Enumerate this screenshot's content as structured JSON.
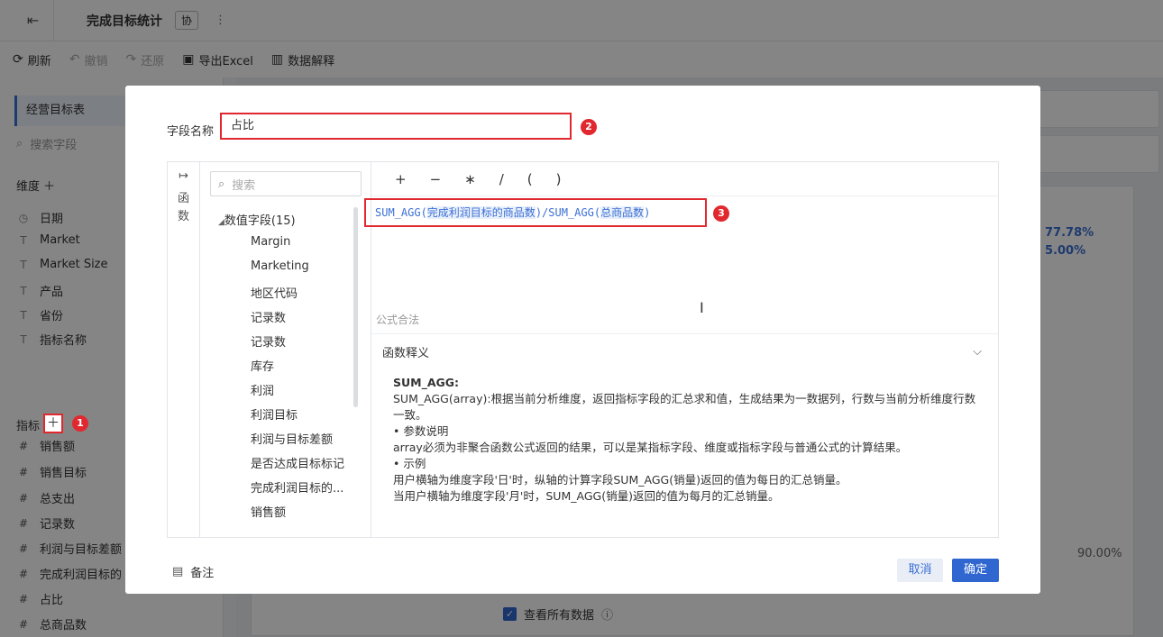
{
  "app": {
    "title": "完成目标统计",
    "badge": "协",
    "more": "⋮"
  },
  "toolbar": {
    "refresh": "刷新",
    "undo": "撤销",
    "redo": "还原",
    "export": "导出Excel",
    "explain": "数据解释"
  },
  "sidebar": {
    "table_name": "经营目标表",
    "search_placeholder": "搜索字段",
    "dimension_label": "维度",
    "dimensions": [
      "日期",
      "Market",
      "Market Size",
      "产品",
      "省份",
      "指标名称"
    ],
    "measure_label": "指标",
    "measures": [
      "销售额",
      "销售目标",
      "总支出",
      "记录数",
      "利润与目标差额",
      "完成利润目标的",
      "占比",
      "总商品数"
    ]
  },
  "background": {
    "pct1": "77.78%",
    "pct2": "5.00%",
    "pct3": "90.00%",
    "view_all": "查看所有数据"
  },
  "dialog": {
    "field_name_label": "字段名称",
    "field_name_value": "占比",
    "rail_label_1": "函",
    "rail_label_2": "数",
    "search_placeholder": "搜索",
    "group_label": "数值字段(15)",
    "fields": [
      "Margin",
      "Marketing",
      "地区代码",
      "记录数",
      "记录数",
      "库存",
      "利润",
      "利润目标",
      "利润与目标差额",
      "是否达成目标标记",
      "完成利润目标的...",
      "销售额"
    ],
    "operators": [
      "+",
      "−",
      "∗",
      "/",
      "(",
      ")"
    ],
    "formula": {
      "fn1": "SUM_AGG(",
      "arg1": "完成利润目标的商品数",
      "mid": ")/SUM_AGG(",
      "arg2": "总商品数",
      "end": ")"
    },
    "valid_text": "公式合法",
    "desc_title": "函数释义",
    "desc": {
      "name": "SUM_AGG:",
      "line1": "SUM_AGG(array):根据当前分析维度，返回指标字段的汇总求和值，生成结果为一数据列，行数与当前分析维度行数一致。",
      "param_head": "• 参数说明",
      "param": "array必须为非聚合函数公式返回的结果，可以是某指标字段、维度或指标字段与普通公式的计算结果。",
      "example_head": "• 示例",
      "ex1": "用户横轴为维度字段'日'时，纵轴的计算字段SUM_AGG(销量)返回的值为每日的汇总销量。",
      "ex2": "当用户横轴为维度字段'月'时，SUM_AGG(销量)返回的值为每月的汇总销量。"
    },
    "note_label": "备注",
    "cancel_label": "取消",
    "ok_label": "确定"
  },
  "markers": [
    "1",
    "2",
    "3"
  ]
}
